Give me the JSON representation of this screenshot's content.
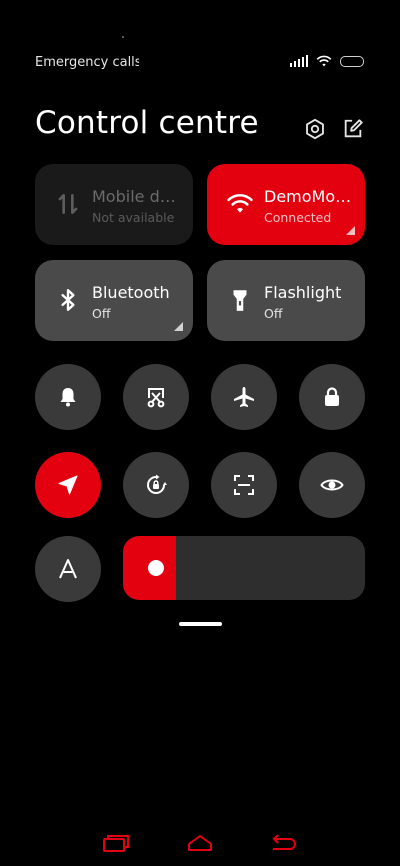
{
  "status_bar": {
    "left_text": "Emergency calls only",
    "icons": [
      "signal-icon",
      "wifi-icon",
      "battery-icon"
    ]
  },
  "header": {
    "title": "Control centre",
    "icons": [
      "settings-icon",
      "edit-icon"
    ]
  },
  "tiles": [
    {
      "name": "mobile-data",
      "label": "Mobile data",
      "sub": "Not available",
      "state": "disabled",
      "icon": "mobile-data-icon"
    },
    {
      "name": "wifi",
      "label": "DemoMode",
      "sub": "Connected",
      "state": "on",
      "icon": "wifi-icon"
    },
    {
      "name": "bluetooth",
      "label": "Bluetooth",
      "sub": "Off",
      "state": "off",
      "icon": "bluetooth-icon"
    },
    {
      "name": "flashlight",
      "label": "Flashlight",
      "sub": "Off",
      "state": "off",
      "icon": "flashlight-icon"
    }
  ],
  "toggles": [
    {
      "name": "ring",
      "icon": "bell-icon",
      "state": "off"
    },
    {
      "name": "screenshot",
      "icon": "scissors-icon",
      "state": "off"
    },
    {
      "name": "airplane",
      "icon": "airplane-icon",
      "state": "off"
    },
    {
      "name": "lock",
      "icon": "lock-icon",
      "state": "off"
    },
    {
      "name": "location",
      "icon": "location-icon",
      "state": "on"
    },
    {
      "name": "auto-rotate",
      "icon": "rotate-lock-icon",
      "state": "off"
    },
    {
      "name": "scanner",
      "icon": "scan-icon",
      "state": "off"
    },
    {
      "name": "reading-mode",
      "icon": "eye-icon",
      "state": "off"
    },
    {
      "name": "font-size",
      "icon": "font-a-icon",
      "state": "off"
    }
  ],
  "brightness": {
    "level": 0.22
  },
  "colors": {
    "accent": "#e3000f",
    "tile_bg": "#4a4a4a",
    "tile_disabled_bg": "#1a1a1a",
    "round_bg": "#3a3a3a"
  },
  "navbar": {
    "icons": [
      "recents-icon",
      "home-icon",
      "back-icon"
    ]
  }
}
